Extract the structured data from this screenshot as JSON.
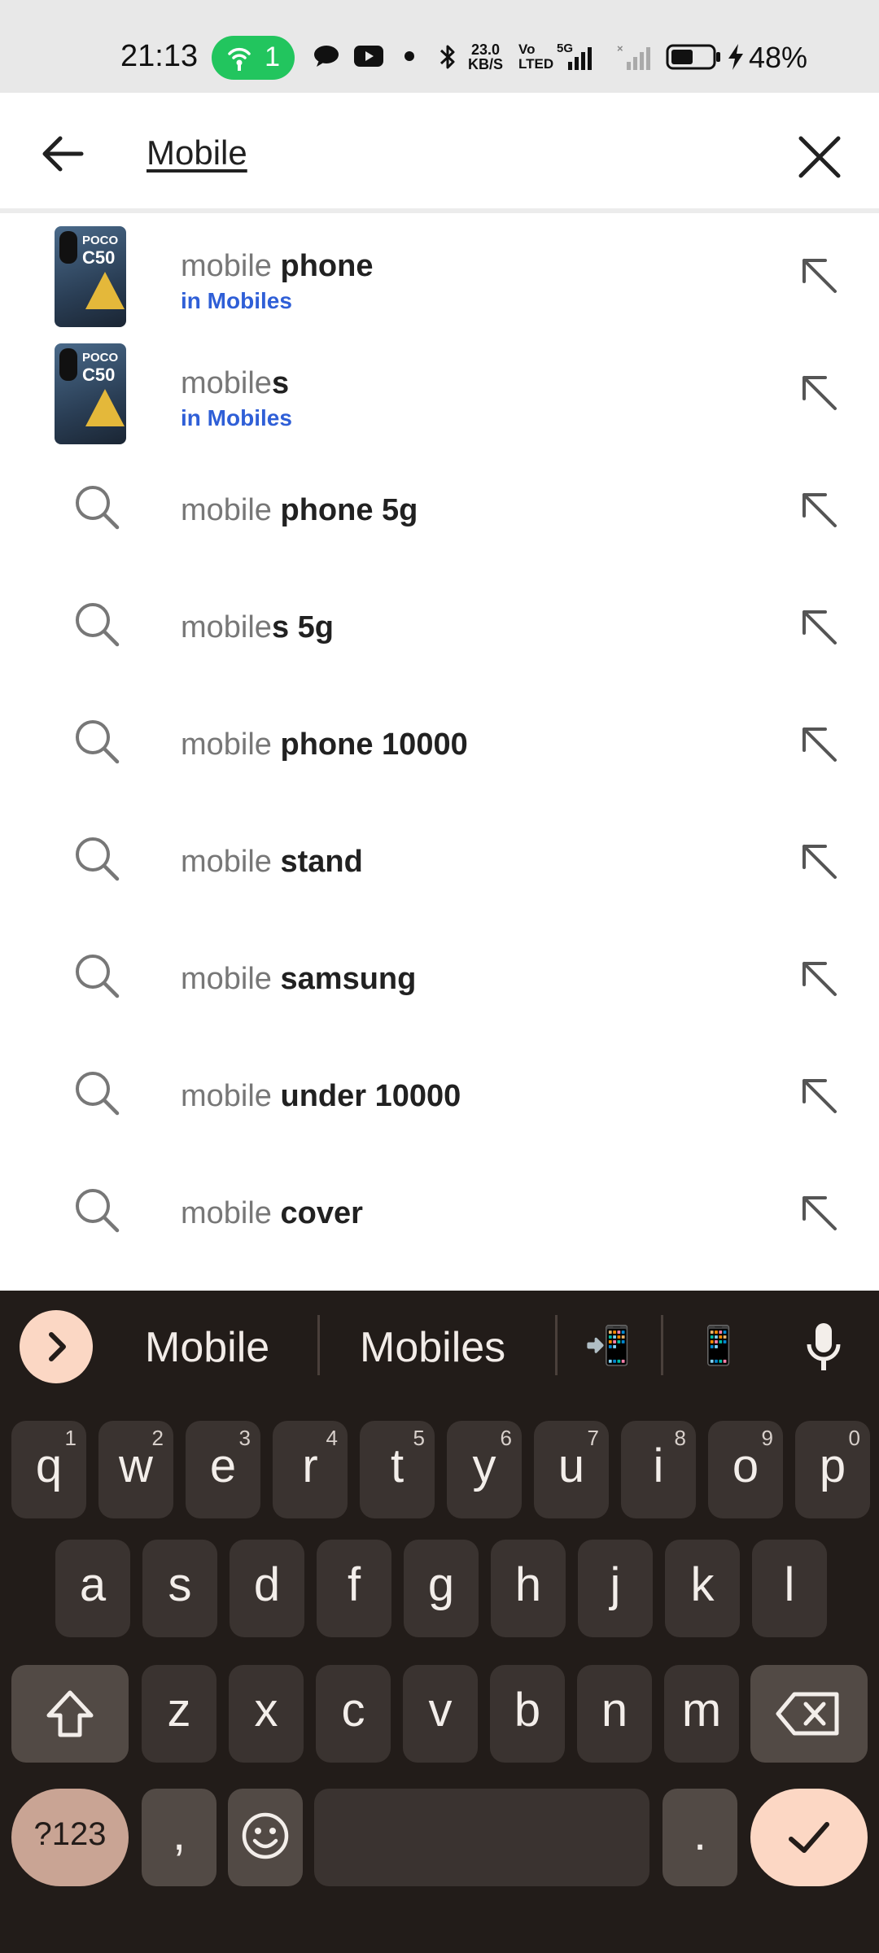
{
  "status_bar": {
    "time": "21:13",
    "hotspot_count": "1",
    "net_speed_value": "23.0",
    "net_speed_unit": "KB/S",
    "volte_top": "Vo",
    "volte_bottom": "LTED",
    "network_type": "5G",
    "battery_percent": "48%"
  },
  "search": {
    "query": "Mobile"
  },
  "suggestions": [
    {
      "prefix": "mobile",
      "completion": " phone",
      "category": "in Mobiles",
      "thumb_brand": "POCO",
      "thumb_model": "C50"
    },
    {
      "prefix": "mobile",
      "completion": "s",
      "category": "in Mobiles",
      "thumb_brand": "POCO",
      "thumb_model": "C50"
    },
    {
      "prefix": "mobile",
      "completion": " phone 5g"
    },
    {
      "prefix": "mobile",
      "completion": "s 5g"
    },
    {
      "prefix": "mobile",
      "completion": " phone 10000"
    },
    {
      "prefix": "mobile",
      "completion": " stand"
    },
    {
      "prefix": "mobile",
      "completion": " samsung"
    },
    {
      "prefix": "mobile",
      "completion": " under 10000"
    },
    {
      "prefix": "mobile",
      "completion": " cover"
    }
  ],
  "keyboard": {
    "suggestions": [
      "Mobile",
      "Mobiles"
    ],
    "emoji_suggestions": [
      "📲",
      "📱"
    ],
    "row1": [
      {
        "key": "q",
        "hint": "1"
      },
      {
        "key": "w",
        "hint": "2"
      },
      {
        "key": "e",
        "hint": "3"
      },
      {
        "key": "r",
        "hint": "4"
      },
      {
        "key": "t",
        "hint": "5"
      },
      {
        "key": "y",
        "hint": "6"
      },
      {
        "key": "u",
        "hint": "7"
      },
      {
        "key": "i",
        "hint": "8"
      },
      {
        "key": "o",
        "hint": "9"
      },
      {
        "key": "p",
        "hint": "0"
      }
    ],
    "row2": [
      "a",
      "s",
      "d",
      "f",
      "g",
      "h",
      "j",
      "k",
      "l"
    ],
    "row3": [
      "z",
      "x",
      "c",
      "v",
      "b",
      "n",
      "m"
    ],
    "symbols_label": "?123",
    "comma": ",",
    "period": "."
  },
  "colors": {
    "hotspot": "#22c55e",
    "category_link": "#2f5fd7",
    "keyboard_bg": "#221c19",
    "accent_key": "#fcd7c4"
  }
}
